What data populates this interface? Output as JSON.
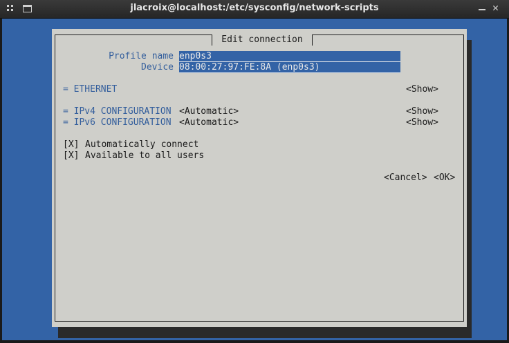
{
  "window": {
    "title": "jlacroix@localhost:/etc/sysconfig/network-scripts"
  },
  "dialog": {
    "title": "Edit connection",
    "profile_name_label": "Profile name",
    "profile_name_value": "enp0s3",
    "device_label": "Device",
    "device_value": "08:00:27:97:FE:8A (enp0s3)",
    "ethernet": {
      "label": "= ETHERNET",
      "toggle": "<Show>"
    },
    "ipv4": {
      "label": "= IPv4 CONFIGURATION",
      "mode": "<Automatic>",
      "toggle": "<Show>"
    },
    "ipv6": {
      "label": "= IPv6 CONFIGURATION",
      "mode": "<Automatic>",
      "toggle": "<Show>"
    },
    "auto_connect": {
      "box": "[X]",
      "label": "Automatically connect"
    },
    "all_users": {
      "box": "[X]",
      "label": "Available to all users"
    },
    "cancel_label": "<Cancel>",
    "ok_label": "<OK>"
  },
  "colors": {
    "terminal_bg": "#3363a6",
    "dialog_bg": "#cfcfca",
    "label_blue": "#335e9c"
  }
}
